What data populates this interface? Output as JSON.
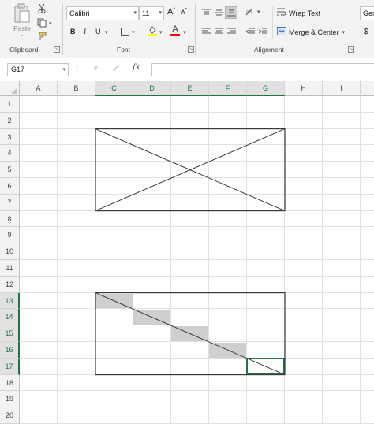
{
  "ribbon": {
    "clipboard": {
      "paste_label": "Paste",
      "group_label": "Clipboard",
      "icons": [
        "cut-icon",
        "copy-icon",
        "format-painter-icon",
        "paste-icon"
      ]
    },
    "font": {
      "font_name": "Calibri",
      "font_size": "11",
      "grow_label": "A",
      "shrink_label": "A",
      "bold": "B",
      "italic": "I",
      "underline": "U",
      "font_color_letter": "A",
      "group_label": "Font",
      "font_color": "#ff0000",
      "highlight_color": "#ffff00"
    },
    "alignment": {
      "wrap_text_label": "Wrap Text",
      "merge_center_label": "Merge & Center",
      "group_label": "Alignment"
    },
    "number": {
      "format_partial": "Gen",
      "currency_symbol": "$"
    }
  },
  "formula_bar": {
    "name_box": "G17",
    "fx_label": "fx",
    "cancel_glyph": "×",
    "enter_glyph": "✓",
    "formula": ""
  },
  "sheet": {
    "columns": [
      "A",
      "B",
      "C",
      "D",
      "E",
      "F",
      "G",
      "H",
      "I"
    ],
    "rows": [
      "1",
      "2",
      "3",
      "4",
      "5",
      "6",
      "7",
      "8",
      "9",
      "10",
      "11",
      "12",
      "13",
      "14",
      "15",
      "16",
      "17",
      "18",
      "19",
      "20"
    ],
    "selected_columns": [
      "C",
      "D",
      "E",
      "F",
      "G"
    ],
    "selected_rows": [
      "13",
      "14",
      "15",
      "16",
      "17"
    ],
    "active_cell": "G17",
    "shaded_cells": [
      "C13",
      "D14",
      "E15",
      "F16"
    ],
    "accent_color": "#217346"
  }
}
